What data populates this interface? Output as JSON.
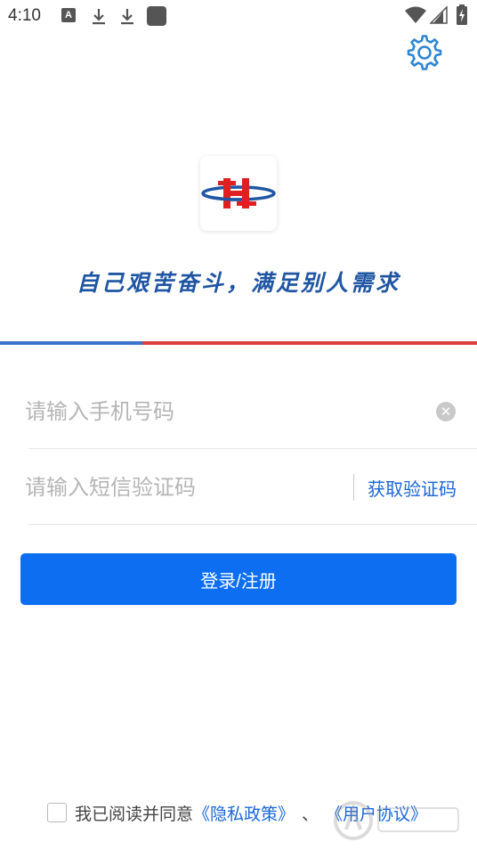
{
  "status_bar": {
    "time": "4:10",
    "icons": [
      "a-badge-icon",
      "download-icon",
      "download-icon",
      "app-square-icon",
      "wifi-icon",
      "signal-icon",
      "battery-charging-icon"
    ]
  },
  "header": {
    "settings_icon": "gear-icon"
  },
  "brand": {
    "slogan": "自己艰苦奋斗，满足别人需求",
    "colors": {
      "blue": "#1f55a3",
      "red": "#d9403f"
    }
  },
  "form": {
    "phone": {
      "placeholder": "请输入手机号码",
      "value": ""
    },
    "code": {
      "placeholder": "请输入短信验证码",
      "value": ""
    },
    "get_code_label": "获取验证码",
    "submit_label": "登录/注册"
  },
  "agreement": {
    "prefix": "我已阅读并同意",
    "privacy_link": "《隐私政策》",
    "separator": "、",
    "terms_link": "《用户协议》",
    "checked": false
  },
  "theme": {
    "accent": "#0d6ef2",
    "link": "#1a66d8"
  }
}
